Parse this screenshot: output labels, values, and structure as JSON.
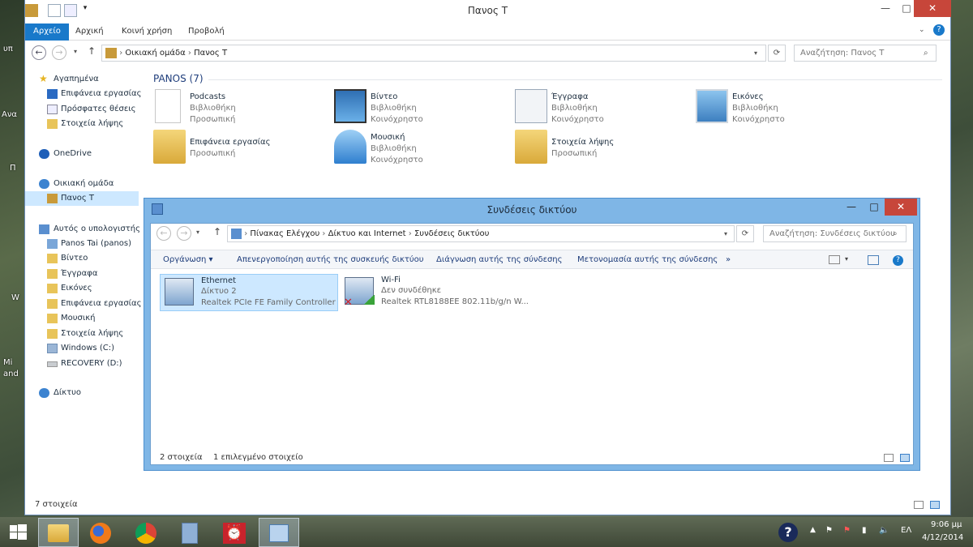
{
  "explorer": {
    "title": "Πανος Τ",
    "ribbon_tabs": [
      "Αρχείο",
      "Αρχική",
      "Κοινή χρήση",
      "Προβολή"
    ],
    "address": {
      "segments": [
        "Οικιακή ομάδα",
        "Πανος Τ"
      ]
    },
    "search_placeholder": "Αναζήτηση: Πανος Τ",
    "nav": {
      "favorites": "Αγαπημένα",
      "favorite_items": [
        "Επιφάνεια εργασίας",
        "Πρόσφατες θέσεις",
        "Στοιχεία λήψης"
      ],
      "onedrive": "OneDrive",
      "homegroup": "Οικιακή ομάδα",
      "homegroup_user": "Πανος Τ",
      "this_pc": "Αυτός ο υπολογιστής",
      "pc_items": [
        "Panos Tai (panos)",
        "Βίντεο",
        "Έγγραφα",
        "Εικόνες",
        "Επιφάνεια εργασίας",
        "Μουσική",
        "Στοιχεία λήψης",
        "Windows (C:)",
        "RECOVERY (D:)"
      ],
      "network": "Δίκτυο"
    },
    "group_header": "PANOS (7)",
    "libraries": [
      {
        "name": "Podcasts",
        "type": "Βιβλιοθήκη",
        "share": "Προσωπική",
        "icon": "blank-file-icon"
      },
      {
        "name": "Βίντεο",
        "type": "Βιβλιοθήκη",
        "share": "Κοινόχρηστο",
        "icon": "video-library-icon"
      },
      {
        "name": "Έγγραφα",
        "type": "Βιβλιοθήκη",
        "share": "Κοινόχρηστο",
        "icon": "documents-library-icon"
      },
      {
        "name": "Εικόνες",
        "type": "Βιβλιοθήκη",
        "share": "Κοινόχρηστο",
        "icon": "pictures-library-icon"
      },
      {
        "name": "Επιφάνεια εργασίας",
        "share": "Προσωπική",
        "icon": "desktop-folder-icon"
      },
      {
        "name": "Μουσική",
        "type": "Βιβλιοθήκη",
        "share": "Κοινόχρηστο",
        "icon": "music-library-icon"
      },
      {
        "name": "Στοιχεία λήψης",
        "share": "Προσωπική",
        "icon": "downloads-folder-icon"
      }
    ],
    "status": "7 στοιχεία"
  },
  "netwin": {
    "title": "Συνδέσεις δικτύου",
    "address": {
      "segments": [
        "Πίνακας Ελέγχου",
        "Δίκτυο και Internet",
        "Συνδέσεις δικτύου"
      ]
    },
    "search_placeholder": "Αναζήτηση: Συνδέσεις δικτύου",
    "commands": {
      "organize": "Οργάνωση",
      "disable": "Απενεργοποίηση αυτής της συσκευής δικτύου",
      "diagnose": "Διάγνωση αυτής της σύνδεσης",
      "rename": "Μετονομασία αυτής της σύνδεσης",
      "more": "»"
    },
    "connections": [
      {
        "name": "Ethernet",
        "status": "Δίκτυο  2",
        "device": "Realtek PCIe FE Family Controller",
        "selected": true
      },
      {
        "name": "Wi-Fi",
        "status": "Δεν συνδέθηκε",
        "device": "Realtek RTL8188EE 802.11b/g/n W...",
        "selected": false
      }
    ],
    "status_count": "2 στοιχεία",
    "status_selected": "1 επιλεγμένο στοιχείο"
  },
  "desktop": {
    "edge_labels": [
      "υπ",
      "Ανα",
      "Π",
      "W",
      "Mi",
      "and"
    ]
  },
  "taskbar": {
    "apps": [
      "start-icon",
      "file-explorer-icon",
      "firefox-icon",
      "chrome-icon",
      "calculator-icon",
      "alarm-clock-icon",
      "network-connections-icon"
    ],
    "language": "ΕΛ",
    "time": "9:06 μμ",
    "date": "4/12/2014"
  },
  "colors": {
    "accent": "#1979ca",
    "close": "#c7463a",
    "selection": "#cde8ff",
    "net_frame": "#7fb6e6"
  }
}
